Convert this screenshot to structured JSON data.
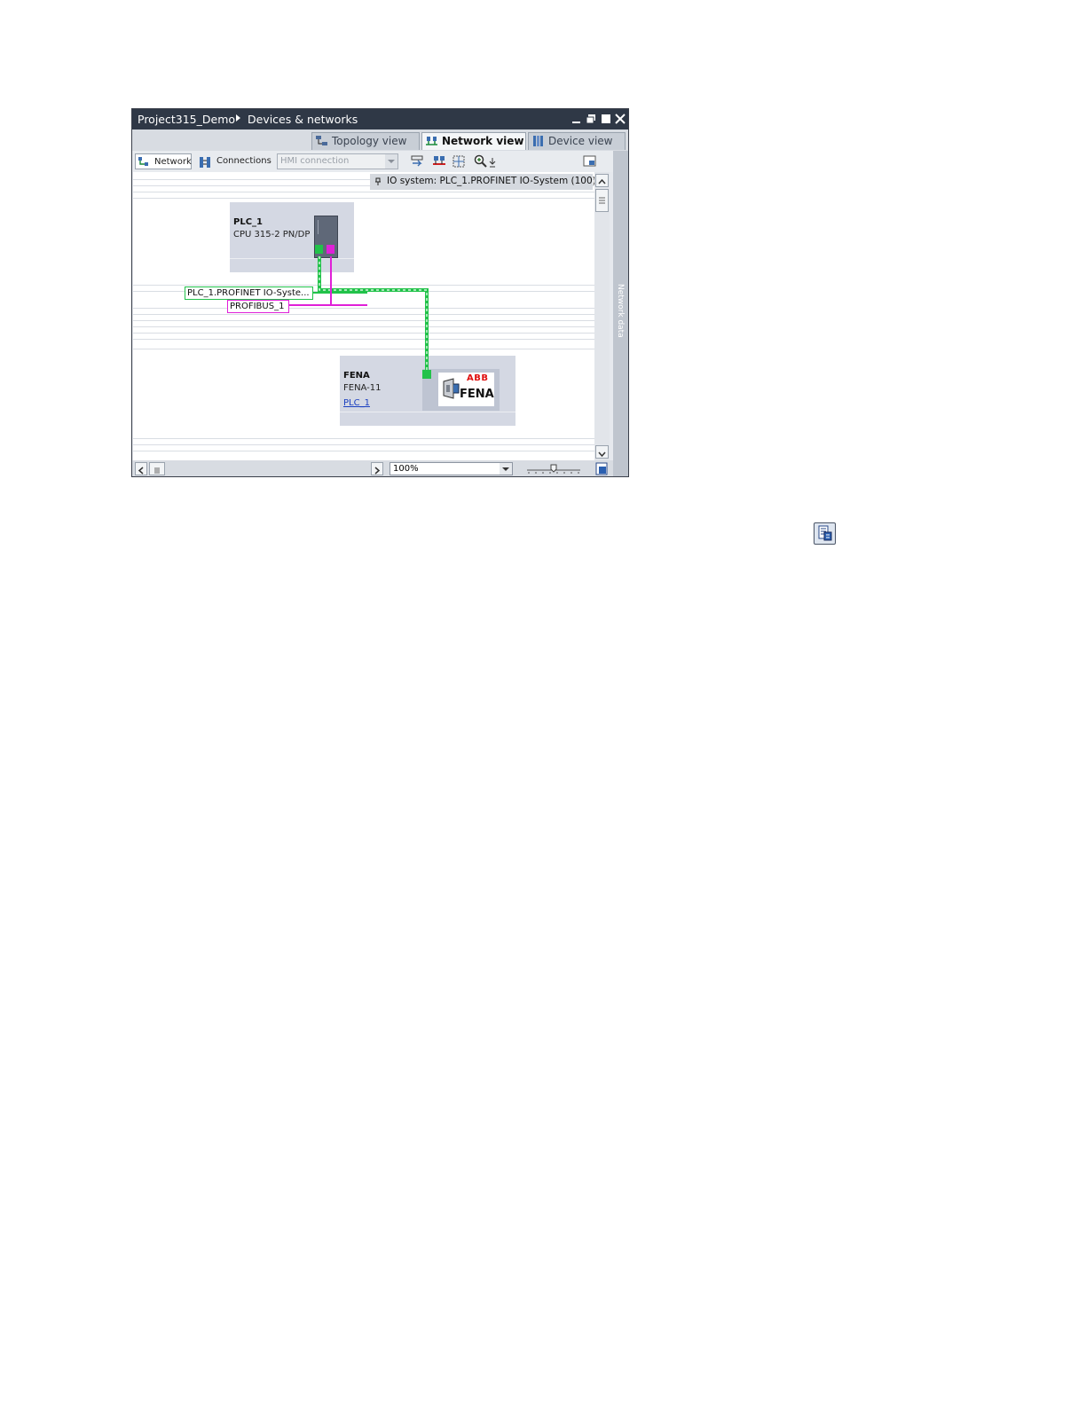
{
  "window": {
    "breadcrumb": [
      "Project315_Demo",
      "Devices & networks"
    ]
  },
  "tabs": [
    {
      "label": "Topology view",
      "active": false
    },
    {
      "label": "Network view",
      "active": true
    },
    {
      "label": "Device view",
      "active": false
    }
  ],
  "toolbar": {
    "network_label": "Network",
    "connections_label": "Connections",
    "connection_type_value": "HMI connection"
  },
  "canvas": {
    "io_system_banner": "IO system: PLC_1.PROFINET IO-System (100)",
    "devices": {
      "plc": {
        "name": "PLC_1",
        "type": "CPU 315-2 PN/DP"
      },
      "fena": {
        "name": "FENA",
        "type": "FENA-11",
        "controller_link": "PLC_1",
        "logo_brand": "ABB",
        "logo_product": "FENA"
      }
    },
    "networks": {
      "profinet_label": "PLC_1.PROFINET IO-Syste...",
      "profibus_label": "PROFIBUS_1"
    }
  },
  "side_panel": {
    "label": "Network data"
  },
  "bottom": {
    "zoom_value": "100%"
  },
  "colors": {
    "titlebar": "#2f3846",
    "profinet": "#22c24a",
    "profibus": "#e020d8",
    "device_bg": "#d4d8e3",
    "module": "#5f6878"
  },
  "icons": {
    "external_button": "network-data-icon"
  }
}
